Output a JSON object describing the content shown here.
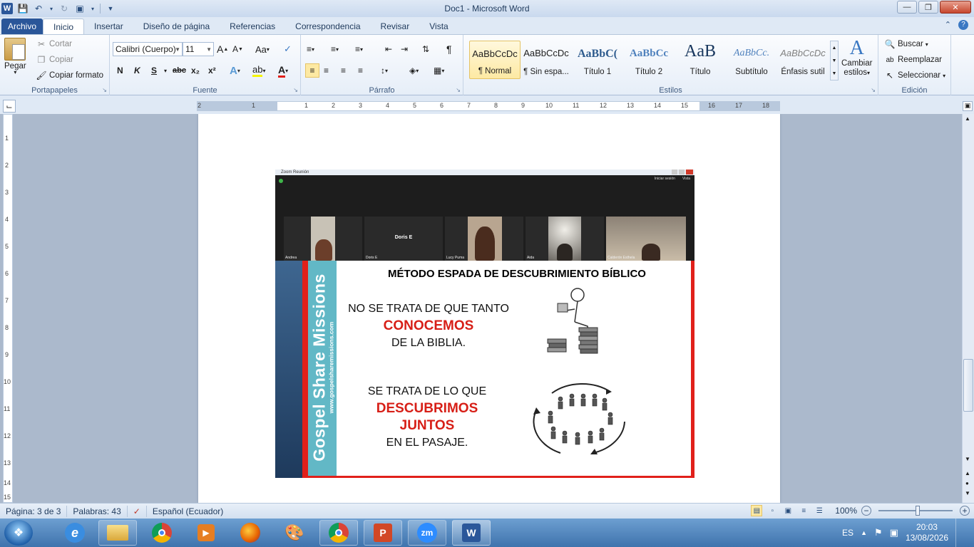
{
  "window": {
    "title": "Doc1  -  Microsoft Word",
    "app_icon": "W"
  },
  "tabs": {
    "file": "Archivo",
    "items": [
      "Inicio",
      "Insertar",
      "Diseño de página",
      "Referencias",
      "Correspondencia",
      "Revisar",
      "Vista"
    ]
  },
  "clipboard": {
    "paste": "Pegar",
    "cut": "Cortar",
    "copy": "Copiar",
    "format_painter": "Copiar formato",
    "label": "Portapapeles"
  },
  "font": {
    "name": "Calibri (Cuerpo)",
    "size": "11",
    "label": "Fuente",
    "bold": "N",
    "italic": "K",
    "underline": "S",
    "strike": "abc",
    "sub": "x₂",
    "sup": "x²"
  },
  "paragraph": {
    "label": "Párrafo"
  },
  "styles": {
    "label": "Estilos",
    "items": [
      {
        "sample": "AaBbCcDc",
        "name": "¶ Normal"
      },
      {
        "sample": "AaBbCcDc",
        "name": "¶ Sin espa..."
      },
      {
        "sample": "AaBbC(",
        "name": "Título 1"
      },
      {
        "sample": "AaBbCc",
        "name": "Título 2"
      },
      {
        "sample": "AaB",
        "name": "Título"
      },
      {
        "sample": "AaBbCc.",
        "name": "Subtítulo"
      },
      {
        "sample": "AaBbCcDc",
        "name": "Énfasis sutil"
      }
    ],
    "change": "Cambiar",
    "change2": "estilos"
  },
  "editing": {
    "find": "Buscar",
    "replace": "Reemplazar",
    "select": "Seleccionar",
    "label": "Edición"
  },
  "ruler": {
    "ticks": [
      "2",
      "1",
      "1",
      "2",
      "3",
      "4",
      "5",
      "6",
      "7",
      "8",
      "9",
      "10",
      "11",
      "12",
      "13",
      "14",
      "15",
      "16",
      "17",
      "18"
    ],
    "vticks": [
      "1",
      "2",
      "3",
      "4",
      "5",
      "6",
      "7",
      "8",
      "9",
      "10",
      "11",
      "12",
      "13",
      "14",
      "15"
    ]
  },
  "zoom_window": {
    "title": "Zoom Reunión",
    "top_right_1": "Iniciar sesión",
    "top_right_2": "Vista",
    "participants": [
      "Andrea",
      "Doris E",
      "Lucy Puma",
      "Aida",
      "Calderón Esthela"
    ],
    "center_name": "Doris E"
  },
  "slide": {
    "brand": "Gospel Share Missions",
    "url": "www.gospelsharemissions.com",
    "title": "MÉTODO ESPADA DE DESCUBRIMIENTO BÍBLICO",
    "block1_line1": "NO SE TRATA DE QUE TANTO",
    "block1_red": "CONOCEMOS",
    "block1_line3": "DE LA BIBLIA.",
    "block2_line1": "SE TRATA DE LO QUE",
    "block2_red1": "DESCUBRIMOS",
    "block2_red2": "JUNTOS",
    "block2_line4": "EN EL PASAJE."
  },
  "status": {
    "page": "Página: 3 de 3",
    "words": "Palabras: 43",
    "language": "Español (Ecuador)",
    "zoom": "100%"
  },
  "taskbar": {
    "zm": "zm",
    "lang": "ES",
    "time": "20:03",
    "date": "13/08/2026"
  },
  "colors": {
    "file_tab": "#2a5699",
    "slide_red": "#d71f17",
    "teal": "#62b8c6"
  }
}
